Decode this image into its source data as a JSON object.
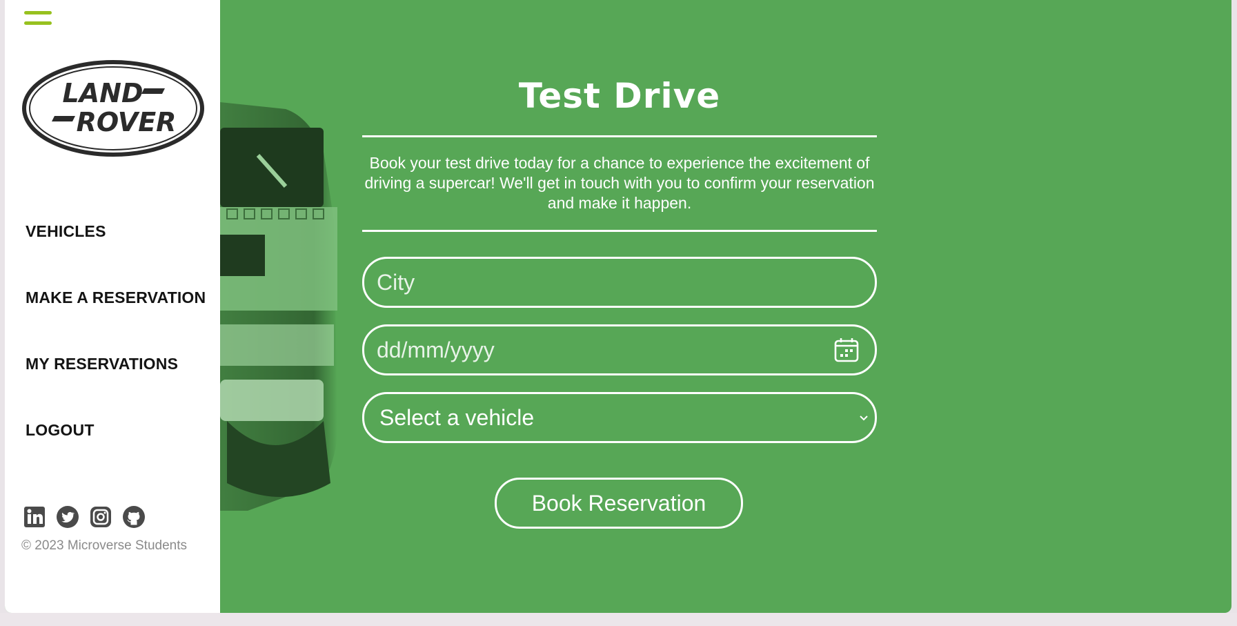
{
  "brand": {
    "logo_line1": "LAND",
    "logo_line2": "ROVER",
    "accent_color": "#97c11f",
    "main_bg_color": "#57a756"
  },
  "sidebar": {
    "menu_icon": "hamburger-menu-icon",
    "nav": [
      {
        "label": "VEHICLES"
      },
      {
        "label": "MAKE A RESERVATION"
      },
      {
        "label": "MY RESERVATIONS"
      },
      {
        "label": "LOGOUT"
      }
    ],
    "social_icons": [
      "linkedin-icon",
      "twitter-icon",
      "instagram-icon",
      "github-icon"
    ],
    "copyright": "© 2023 Microverse Students"
  },
  "form": {
    "title": "Test Drive",
    "description": "Book your test drive today for a chance to experience the excitement of driving a supercar! We'll get in touch with you to confirm your reservation and make it happen.",
    "city_placeholder": "City",
    "date_placeholder": "dd/mm/yyyy",
    "date_icon": "calendar-icon",
    "vehicle_select": "Select a vehicle",
    "vehicle_select_icon": "chevron-down-icon",
    "submit_label": "Book Reservation"
  }
}
